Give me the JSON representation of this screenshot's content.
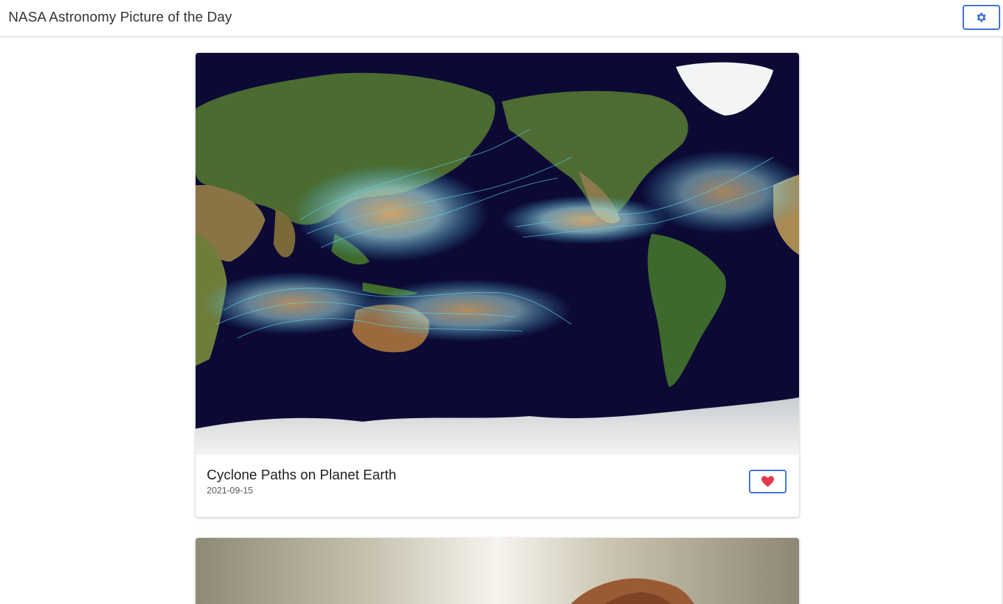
{
  "header": {
    "title": "NASA Astronomy Picture of the Day",
    "settings_icon": "gear-icon"
  },
  "colors": {
    "accent": "#3b6fd8",
    "heart": "#e8384f",
    "ocean": "#0c0a35",
    "land": "#4b6b30",
    "cyclone_track": "#5ad6ee"
  },
  "posts": [
    {
      "title": "Cyclone Paths on Planet Earth",
      "date": "2021-09-15",
      "image_subject": "world map with cyclone tracks",
      "like_icon": "heart-icon"
    },
    {
      "image_subject": "rocky landscape"
    }
  ]
}
